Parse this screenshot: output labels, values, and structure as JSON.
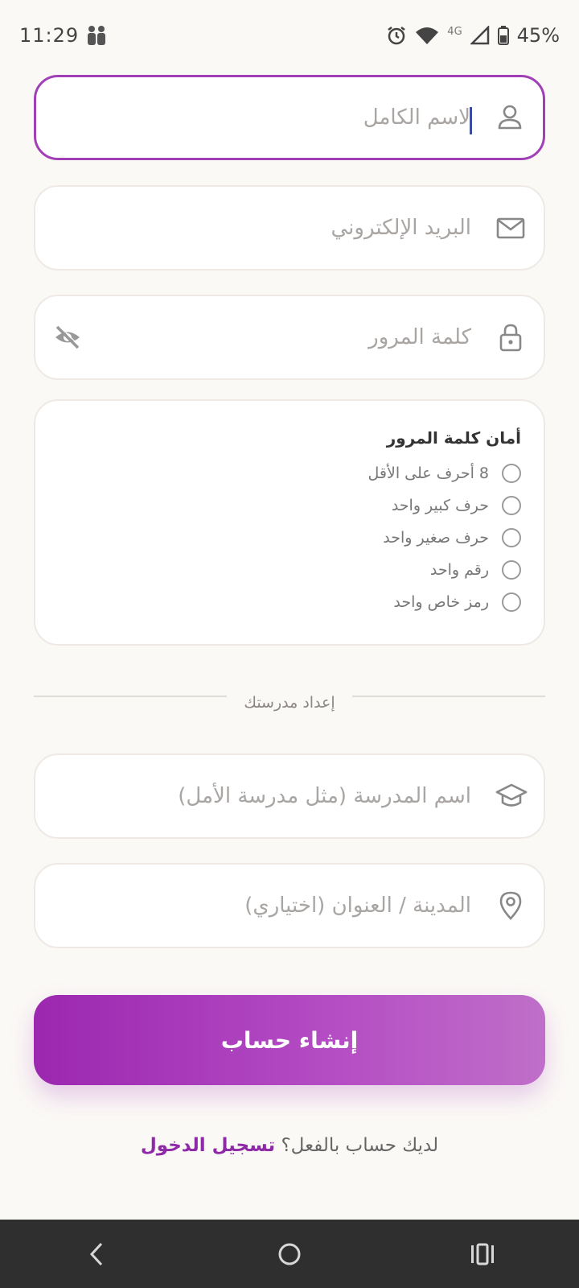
{
  "status": {
    "time": "11:29",
    "network": "4G",
    "battery": "45%"
  },
  "form": {
    "full_name": {
      "placeholder": "لاسم الكامل",
      "icon": "person-icon"
    },
    "email": {
      "placeholder": "البريد الإلكتروني",
      "icon": "mail-icon"
    },
    "password": {
      "placeholder": "كلمة المرور",
      "icon": "lock-icon",
      "toggle_icon": "eye-off-icon"
    }
  },
  "strength": {
    "title": "أمان كلمة المرور",
    "requirements": [
      {
        "label": "8 أحرف على الأقل",
        "met": false
      },
      {
        "label": "حرف كبير واحد",
        "met": false
      },
      {
        "label": "حرف صغير واحد",
        "met": false
      },
      {
        "label": "رقم واحد",
        "met": false
      },
      {
        "label": "رمز خاص واحد",
        "met": false
      }
    ]
  },
  "school_section": {
    "divider_label": "إعداد مدرستك",
    "school_name": {
      "placeholder": "اسم المدرسة (مثل مدرسة الأمل)",
      "icon": "graduation-cap-icon"
    },
    "city": {
      "placeholder": "المدينة / العنوان (اختياري)",
      "icon": "location-pin-icon"
    }
  },
  "submit_label": "إنشاء حساب",
  "footer": {
    "prompt": "لديك حساب بالفعل؟",
    "link": "تسجيل الدخول"
  },
  "colors": {
    "accent": "#9c27b0",
    "background": "#fbf9f6"
  }
}
